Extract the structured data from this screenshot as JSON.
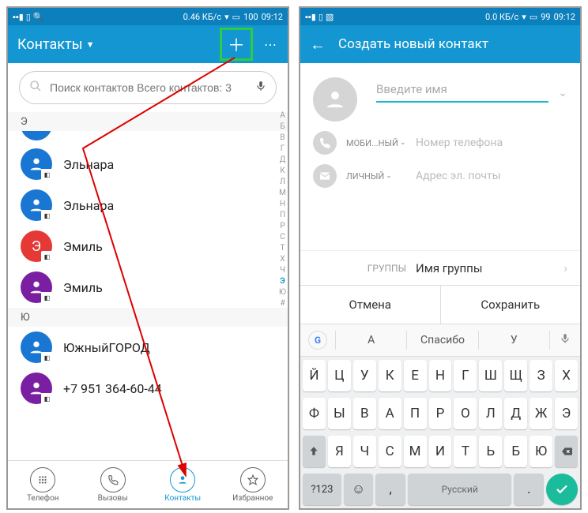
{
  "status": {
    "data_rate_left": "0.46 КБ/с",
    "data_rate_right": "0.0 КБ/с",
    "battery_left": "100",
    "battery_right": "99",
    "time": "09:12"
  },
  "left": {
    "title": "Контакты",
    "search_placeholder": "Поиск контактов Всего контактов: 3",
    "index": [
      "А",
      "Б",
      "В",
      "Г",
      "Д",
      "К",
      "Л",
      "М",
      "Н",
      "П",
      "Р",
      "С",
      "Т",
      "Х",
      "Ч",
      "Э",
      "Ю",
      "#"
    ],
    "sections": [
      {
        "letter": "Э",
        "items": [
          {
            "name": "Эльнара",
            "color": "#1976d2"
          },
          {
            "name": "Эльнара",
            "color": "#1976d2"
          },
          {
            "name": "Эмиль",
            "color": "#e53935"
          },
          {
            "name": "Эмиль",
            "color": "#7b1fa2"
          }
        ]
      },
      {
        "letter": "Ю",
        "items": [
          {
            "name": "ЮжныйГОРОД",
            "color": "#1976d2"
          },
          {
            "name": "+7 951 364-60-44",
            "color": "#7b1fa2"
          }
        ]
      }
    ],
    "nav": [
      "Телефон",
      "Вызовы",
      "Контакты",
      "Избранное"
    ]
  },
  "right": {
    "title": "Создать новый контакт",
    "name_placeholder": "Введите имя",
    "phone_type": "МОБИ...НЫЙ",
    "phone_placeholder": "Номер телефона",
    "email_type": "ЛИЧНЫЙ",
    "email_placeholder": "Адрес эл. почты",
    "group_label": "ГРУППЫ",
    "group_value": "Имя группы",
    "cancel": "Отмена",
    "save": "Сохранить",
    "suggestions": [
      "А",
      "Спасибо",
      "У"
    ],
    "kb_lang": "Русский",
    "kb_123": "?123",
    "rows": [
      [
        "Й",
        "Ц",
        "У",
        "К",
        "Е",
        "Н",
        "Г",
        "Ш",
        "Щ",
        "З",
        "Х"
      ],
      [
        "Ф",
        "Ы",
        "В",
        "А",
        "П",
        "Р",
        "О",
        "Л",
        "Д",
        "Ж",
        "Э"
      ],
      [
        "Я",
        "Ч",
        "С",
        "М",
        "И",
        "Т",
        "Ь",
        "Б",
        "Ю"
      ]
    ]
  }
}
